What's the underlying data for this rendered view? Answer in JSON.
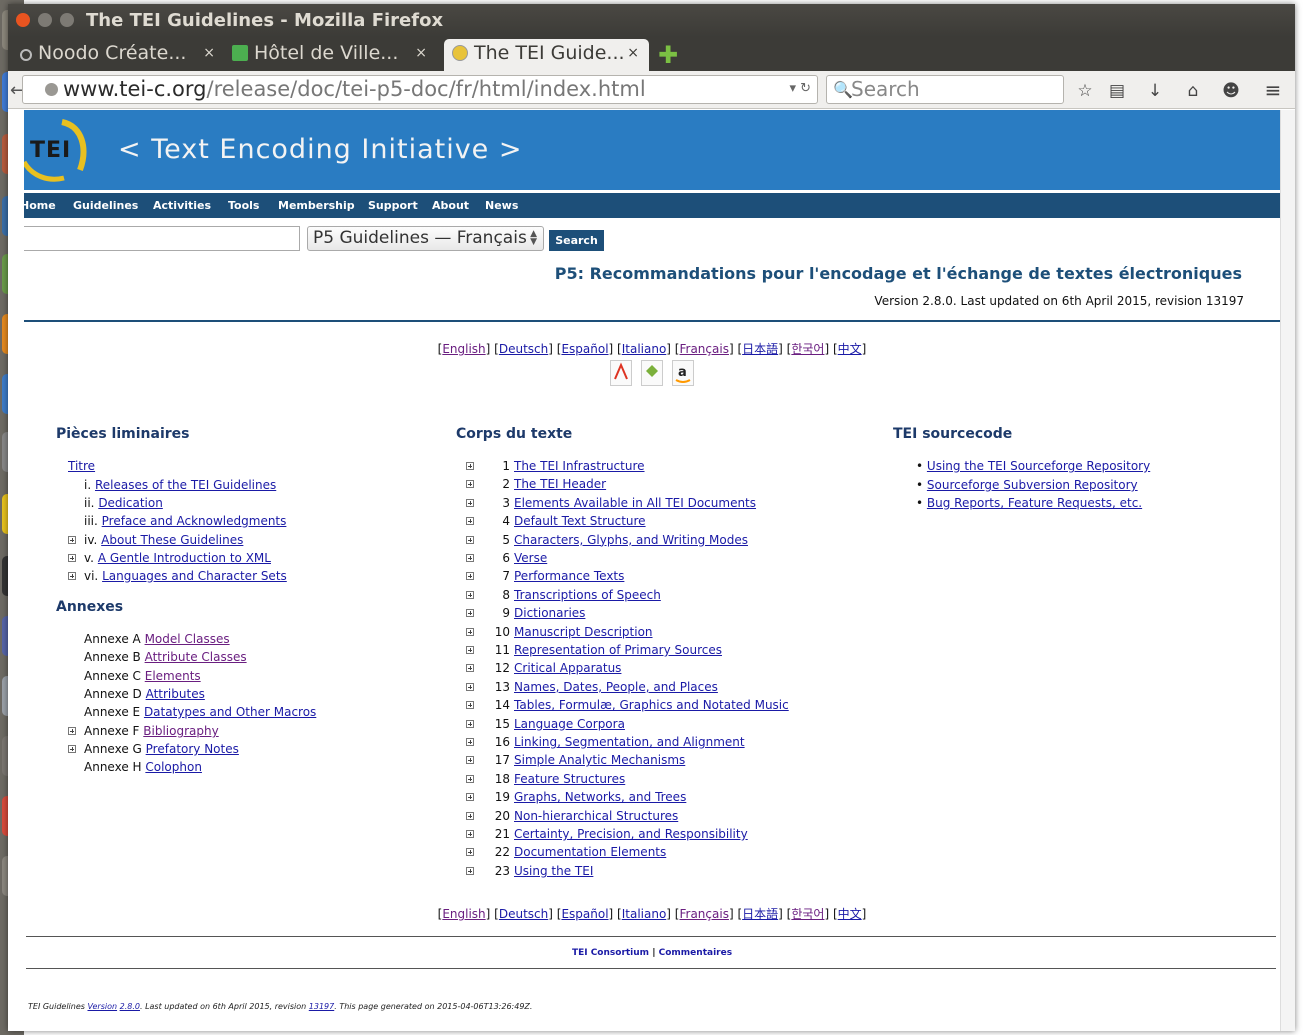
{
  "window": {
    "title": "The TEI Guidelines - Mozilla Firefox"
  },
  "tabs": [
    {
      "label": "Noodo Créate...",
      "close": "×"
    },
    {
      "label": "Hôtel de Ville...",
      "close": "×"
    },
    {
      "label": "The TEI Guide...",
      "close": "×"
    }
  ],
  "newtab": "✚",
  "urlbar": {
    "domain": "www.tei-c.org",
    "path": "/release/doc/tei-p5-doc/fr/html/index.html",
    "controls": "▾ ↻"
  },
  "searchbar": {
    "placeholder": "Search",
    "glass": "🔍"
  },
  "nav_icons": {
    "bookmark": "☆",
    "reader": "▤",
    "download": "↓",
    "home": "⌂",
    "chat": "☻",
    "menu": "≡"
  },
  "banner": {
    "logo": "TEI",
    "title": "< Text Encoding Initiative >"
  },
  "menu": [
    "Home",
    "Guidelines",
    "Activities",
    "Tools",
    "Membership",
    "Support",
    "About",
    "News"
  ],
  "site_search": {
    "select_value": "P5 Guidelines — Français",
    "button": "Search"
  },
  "header": {
    "title": "P5: Recommandations pour l'encodage et l'échange de textes électroniques",
    "version": "Version 2.8.0. Last updated on 6th April 2015, revision 13197"
  },
  "languages": [
    "English",
    "Deutsch",
    "Español",
    "Italiano",
    "Français",
    "日本語",
    "한국어",
    "中文"
  ],
  "doc_icons": [
    "pdf-icon",
    "epub-icon",
    "amazon-icon"
  ],
  "front": {
    "heading": "Pièces liminaires",
    "titre": "Titre",
    "items": [
      {
        "num": "i.",
        "label": "Releases of the TEI Guidelines",
        "expand": false
      },
      {
        "num": "ii.",
        "label": "Dedication",
        "expand": false
      },
      {
        "num": "iii.",
        "label": "Preface and Acknowledgments",
        "expand": false
      },
      {
        "num": "iv.",
        "label": "About These Guidelines",
        "expand": true
      },
      {
        "num": "v.",
        "label": "A Gentle Introduction to XML",
        "expand": true
      },
      {
        "num": "vi.",
        "label": "Languages and Character Sets",
        "expand": true
      }
    ]
  },
  "annexes": {
    "heading": "Annexes",
    "items": [
      {
        "num": "Annexe A",
        "label": "Model Classes",
        "expand": false
      },
      {
        "num": "Annexe B",
        "label": "Attribute Classes",
        "expand": false
      },
      {
        "num": "Annexe C",
        "label": "Elements",
        "expand": false
      },
      {
        "num": "Annexe D",
        "label": "Attributes",
        "expand": false
      },
      {
        "num": "Annexe E",
        "label": "Datatypes and Other Macros",
        "expand": false
      },
      {
        "num": "Annexe F",
        "label": "Bibliography",
        "expand": true
      },
      {
        "num": "Annexe G",
        "label": "Prefatory Notes",
        "expand": true
      },
      {
        "num": "Annexe H",
        "label": "Colophon",
        "expand": false
      }
    ]
  },
  "body": {
    "heading": "Corps du texte",
    "items": [
      {
        "num": "1",
        "label": "The TEI Infrastructure"
      },
      {
        "num": "2",
        "label": "The TEI Header"
      },
      {
        "num": "3",
        "label": "Elements Available in All TEI Documents"
      },
      {
        "num": "4",
        "label": "Default Text Structure"
      },
      {
        "num": "5",
        "label": "Characters, Glyphs, and Writing Modes"
      },
      {
        "num": "6",
        "label": "Verse"
      },
      {
        "num": "7",
        "label": "Performance Texts"
      },
      {
        "num": "8",
        "label": "Transcriptions of Speech"
      },
      {
        "num": "9",
        "label": "Dictionaries"
      },
      {
        "num": "10",
        "label": "Manuscript Description"
      },
      {
        "num": "11",
        "label": "Representation of Primary Sources"
      },
      {
        "num": "12",
        "label": "Critical Apparatus"
      },
      {
        "num": "13",
        "label": "Names, Dates, People, and Places"
      },
      {
        "num": "14",
        "label": "Tables, Formulæ, Graphics and Notated Music"
      },
      {
        "num": "15",
        "label": "Language Corpora"
      },
      {
        "num": "16",
        "label": "Linking, Segmentation, and Alignment"
      },
      {
        "num": "17",
        "label": "Simple Analytic Mechanisms"
      },
      {
        "num": "18",
        "label": "Feature Structures"
      },
      {
        "num": "19",
        "label": "Graphs, Networks, and Trees"
      },
      {
        "num": "20",
        "label": "Non-hierarchical Structures"
      },
      {
        "num": "21",
        "label": "Certainty, Precision, and Responsibility"
      },
      {
        "num": "22",
        "label": "Documentation Elements"
      },
      {
        "num": "23",
        "label": "Using the TEI"
      }
    ]
  },
  "sourcecode": {
    "heading": "TEI sourcecode",
    "items": [
      "Using the TEI Sourceforge Repository",
      "Sourceforge Subversion Repository",
      "Bug Reports, Feature Requests, etc."
    ]
  },
  "footer": {
    "consortium": "TEI Consortium",
    "sep": "|",
    "comments": "Commentaires",
    "note_prefix": "TEI Guidelines",
    "note_version_label": "Version",
    "note_version": "2.8.0",
    "note_middle": ". Last updated on 6th April 2015, revision",
    "note_revision": "13197",
    "note_suffix": ". This page generated on 2015-04-06T13:26:49Z."
  }
}
